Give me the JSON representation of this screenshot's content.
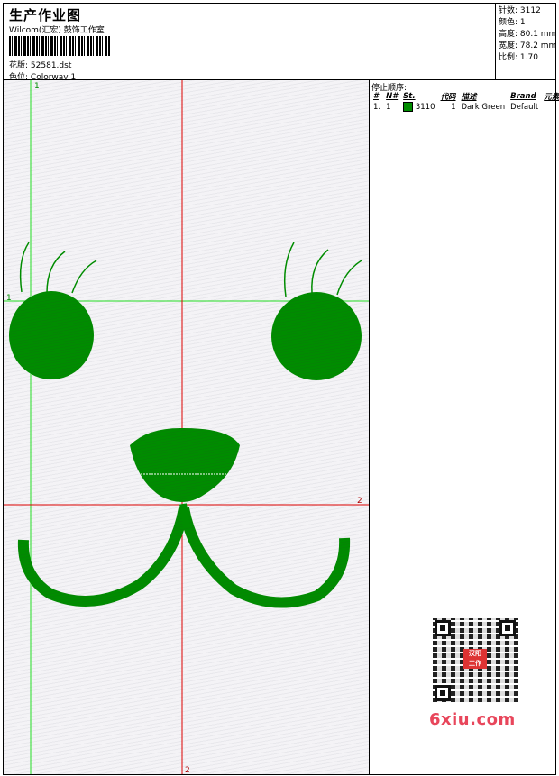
{
  "header": {
    "title": "生产作业图",
    "company": "Wilcom(汇宏) 鼓饰工作室",
    "design_label": "花版:",
    "design_value": "52581.dst",
    "colorway_label": "色位:",
    "colorway_value": "Colorway 1"
  },
  "stats": {
    "stitches": "针数: 3112",
    "colors": "颜色: 1",
    "height": "高度: 80.1 mm",
    "width": "宽度: 78.2 mm",
    "ratio": "比例: 1.70"
  },
  "sequence": {
    "title": "停止顺序:",
    "columns": [
      "#",
      "N#",
      "St.",
      "代码",
      "描述",
      "Brand",
      "元素"
    ],
    "rows": [
      {
        "index": "1.",
        "n": "1",
        "stitches": "3110",
        "code": "1",
        "description": "Dark Green",
        "brand": "Default",
        "element": "",
        "color": "#008c00"
      }
    ]
  },
  "guides": {
    "v1_label": "1",
    "h1_label": "1",
    "h2_label": "2",
    "v2_label": "2"
  },
  "colors": {
    "thread": "#008c00",
    "guide_green": "#22dd22",
    "guide_red": "#dd0000"
  },
  "watermark": {
    "text": "6xiu.com",
    "stamp_line1": "汉阳",
    "stamp_line2": "工作"
  }
}
